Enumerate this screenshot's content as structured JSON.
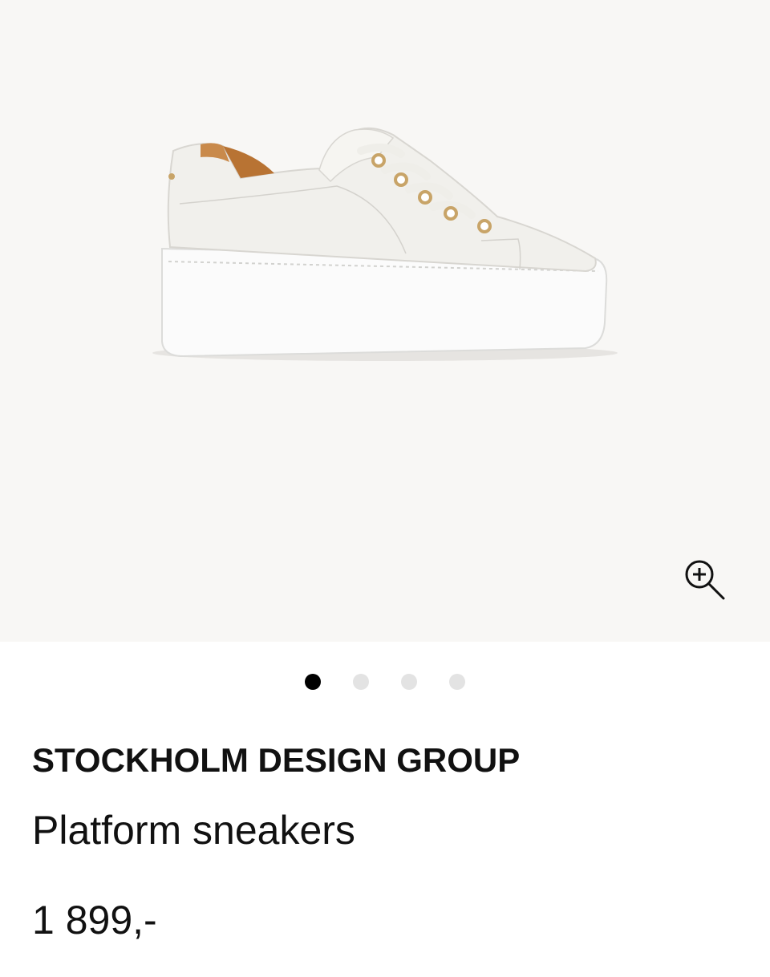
{
  "gallery": {
    "image_alt": "Platform sneakers",
    "zoom_icon": "zoom-in-icon",
    "slide_count": 4,
    "active_slide": 1
  },
  "product": {
    "brand": "STOCKHOLM DESIGN GROUP",
    "name": "Platform sneakers",
    "price": "1 899,-"
  },
  "colors": {
    "gallery_bg": "#f8f7f5",
    "active_dot": "#000000",
    "inactive_dot": "#e3e3e3",
    "text": "#111111"
  }
}
